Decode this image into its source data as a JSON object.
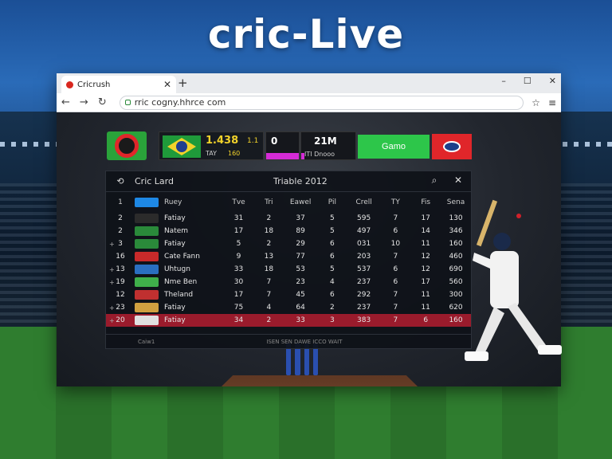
{
  "hero": {
    "title": "cric-Live"
  },
  "browser": {
    "tab_title": "Cricrush",
    "url": "rric cogny.hhrce com",
    "controls": {
      "minimize": "–",
      "maximize": "☐",
      "close": "✕"
    }
  },
  "scorebar": {
    "team1_score": "1.438",
    "team1_overs": "1.1",
    "team1_sub_a": "TAY",
    "team1_sub_b": "160",
    "box2_value": "0",
    "box3_value": "21M",
    "box3_sub": "ITI Dnooo",
    "green_button": "Gamo"
  },
  "panel": {
    "back": "⟲",
    "label": "Cric Lard",
    "heading": "Triable 2012",
    "search_icon": "⌕",
    "close_icon": "✕",
    "columns": [
      "Ruey",
      "Tve",
      "Tri",
      "Eawel",
      "Pil",
      "Crell",
      "TY",
      "Fis",
      "Sena"
    ],
    "first_col_header": "1",
    "rows": [
      {
        "rank": "2",
        "mark": "",
        "team": "Fatiay",
        "flag": "#2b2b2b",
        "vals": [
          "31",
          "2",
          "37",
          "5",
          "595",
          "7",
          "17",
          "130"
        ]
      },
      {
        "rank": "2",
        "mark": "",
        "team": "Natem",
        "flag": "#2a8a3a",
        "vals": [
          "17",
          "18",
          "89",
          "5",
          "497",
          "6",
          "14",
          "346"
        ]
      },
      {
        "rank": "3",
        "mark": "+",
        "team": "Fatiay",
        "flag": "#2a8a3a",
        "vals": [
          "5",
          "2",
          "29",
          "6",
          "031",
          "10",
          "11",
          "160"
        ]
      },
      {
        "rank": "16",
        "mark": "",
        "team": "Cate Fann",
        "flag": "#c82a2a",
        "vals": [
          "9",
          "13",
          "77",
          "6",
          "203",
          "7",
          "12",
          "460"
        ]
      },
      {
        "rank": "13",
        "mark": "+",
        "team": "Uhtugn",
        "flag": "#2a6fc0",
        "vals": [
          "33",
          "18",
          "53",
          "5",
          "537",
          "6",
          "12",
          "690"
        ]
      },
      {
        "rank": "19",
        "mark": "+",
        "team": "Nme Ben",
        "flag": "#3fb04a",
        "vals": [
          "30",
          "7",
          "23",
          "4",
          "237",
          "6",
          "17",
          "560"
        ]
      },
      {
        "rank": "12",
        "mark": "",
        "team": "Theland",
        "flag": "#c03030",
        "vals": [
          "17",
          "7",
          "45",
          "6",
          "292",
          "7",
          "11",
          "300"
        ]
      },
      {
        "rank": "23",
        "mark": "+",
        "team": "Fatiay",
        "flag": "#d0a040",
        "vals": [
          "75",
          "4",
          "64",
          "2",
          "237",
          "7",
          "11",
          "620"
        ]
      },
      {
        "rank": "20",
        "mark": "+",
        "team": "Fatiay",
        "flag": "#e0e0e0",
        "vals": [
          "34",
          "2",
          "33",
          "3",
          "383",
          "7",
          "6",
          "160"
        ]
      }
    ],
    "footer_left": "Caiw1",
    "footer_mid": "ISEN SEN DAWE ICCO WAIT"
  }
}
